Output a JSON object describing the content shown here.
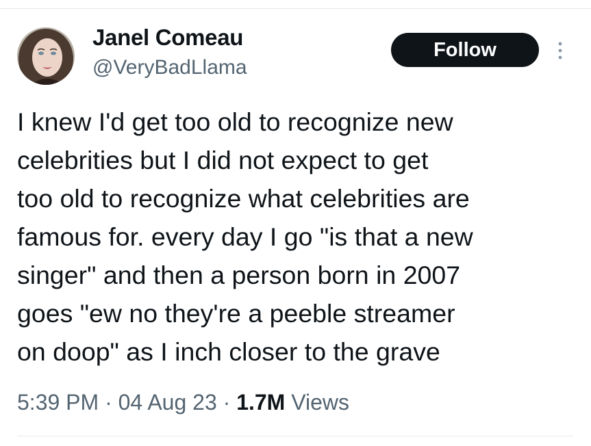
{
  "author": {
    "display_name": "Janel Comeau",
    "handle": "@VeryBadLlama"
  },
  "follow_button": {
    "label": "Follow"
  },
  "icons": {
    "avatar": "profile-photo",
    "more": "vertical-ellipsis-icon"
  },
  "tweet": {
    "lines": [
      "I knew I'd get too old to recognize new",
      "celebrities but I did not expect to get",
      "too old to recognize what celebrities are",
      "famous for. every day I go \"is that a new",
      "singer\" and then a person born in 2007",
      "goes \"ew no they're a peeble streamer",
      "on doop\" as I inch closer to the grave"
    ]
  },
  "meta": {
    "time": "5:39 PM",
    "separator": "·",
    "date": "04 Aug 23",
    "views_count": "1.7M",
    "views_label": "Views"
  },
  "colors": {
    "text_primary": "#0f1419",
    "text_secondary": "#536471",
    "button_bg": "#0f1419",
    "button_text": "#ffffff",
    "divider": "#e6e9ea"
  }
}
